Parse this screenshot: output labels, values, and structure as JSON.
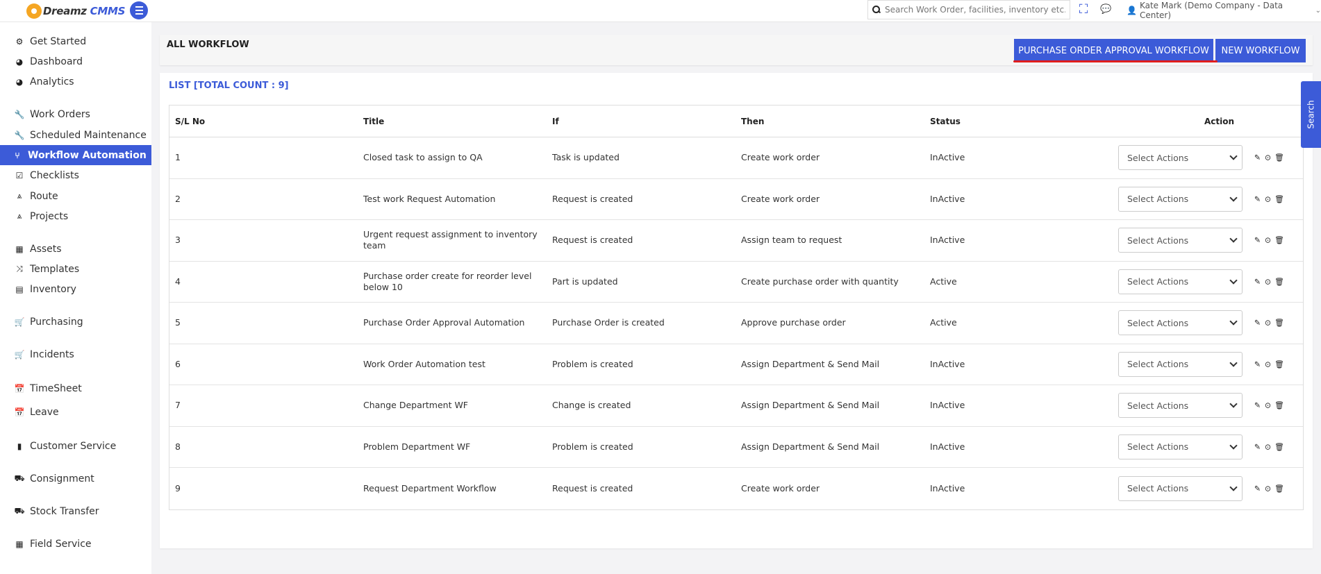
{
  "app": {
    "logo_prefix": "Dreamz",
    "logo_suffix": "CMMS"
  },
  "topbar": {
    "search_placeholder": "Search Work Order, facilities, inventory etc....",
    "user_label": "Kate Mark (Demo Company - Data Center)"
  },
  "sidebar": {
    "items": [
      {
        "label": "Get Started",
        "icon": "gears-icon"
      },
      {
        "label": "Dashboard",
        "icon": "dashboard-icon"
      },
      {
        "label": "Analytics",
        "icon": "analytics-icon"
      },
      {
        "label": "Work Orders",
        "icon": "wrench-icon"
      },
      {
        "label": "Scheduled Maintenance",
        "icon": "wrench-icon"
      },
      {
        "label": "Workflow Automation",
        "icon": "workflow-icon",
        "active": true
      },
      {
        "label": "Checklists",
        "icon": "checkbox-icon"
      },
      {
        "label": "Route",
        "icon": "road-icon"
      },
      {
        "label": "Projects",
        "icon": "road-icon"
      },
      {
        "label": "Assets",
        "icon": "building-icon"
      },
      {
        "label": "Templates",
        "icon": "shuffle-icon"
      },
      {
        "label": "Inventory",
        "icon": "briefcase-icon"
      },
      {
        "label": "Purchasing",
        "icon": "cart-icon"
      },
      {
        "label": "Incidents",
        "icon": "cart-icon"
      },
      {
        "label": "TimeSheet",
        "icon": "calendar-icon"
      },
      {
        "label": "Leave",
        "icon": "calendar-icon"
      },
      {
        "label": "Customer Service",
        "icon": "file-icon"
      },
      {
        "label": "Consignment",
        "icon": "truck-icon"
      },
      {
        "label": "Stock Transfer",
        "icon": "truck-icon"
      },
      {
        "label": "Field Service",
        "icon": "building-icon"
      }
    ]
  },
  "header": {
    "title": "ALL WORKFLOW",
    "po_button": "PURCHASE ORDER APPROVAL WORKFLOW",
    "new_button": "NEW WORKFLOW"
  },
  "list": {
    "title": "LIST [TOTAL COUNT : 9]",
    "columns": {
      "no": "S/L No",
      "title": "Title",
      "if": "If",
      "then": "Then",
      "status": "Status",
      "action": "Action"
    },
    "select_placeholder": "Select Actions",
    "rows": [
      {
        "no": "1",
        "title": "Closed task to assign to QA",
        "if": "Task is updated",
        "then": "Create work order",
        "status": "InActive"
      },
      {
        "no": "2",
        "title": "Test work Request Automation",
        "if": "Request is created",
        "then": "Create work order",
        "status": "InActive"
      },
      {
        "no": "3",
        "title": "Urgent request assignment to inventory team",
        "if": "Request is created",
        "then": "Assign team to request",
        "status": "InActive"
      },
      {
        "no": "4",
        "title": "Purchase order create for reorder level below 10",
        "if": "Part is updated",
        "then": "Create purchase order with quantity",
        "status": "Active"
      },
      {
        "no": "5",
        "title": "Purchase Order Approval Automation",
        "if": "Purchase Order is created",
        "then": "Approve purchase order",
        "status": "Active"
      },
      {
        "no": "6",
        "title": "Work Order Automation test",
        "if": "Problem is created",
        "then": "Assign Department & Send Mail",
        "status": "InActive"
      },
      {
        "no": "7",
        "title": "Change Department WF",
        "if": "Change is created",
        "then": "Assign Department & Send Mail",
        "status": "InActive"
      },
      {
        "no": "8",
        "title": "Problem Department WF",
        "if": "Problem is created",
        "then": "Assign Department & Send Mail",
        "status": "InActive"
      },
      {
        "no": "9",
        "title": "Request Department Workflow",
        "if": "Request is created",
        "then": "Create work order",
        "status": "InActive"
      }
    ]
  },
  "side_tab": {
    "label": "Search"
  },
  "colors": {
    "primary": "#3c5bd8",
    "highlight": "#e01e1e",
    "logo_accent": "#f5a623"
  }
}
